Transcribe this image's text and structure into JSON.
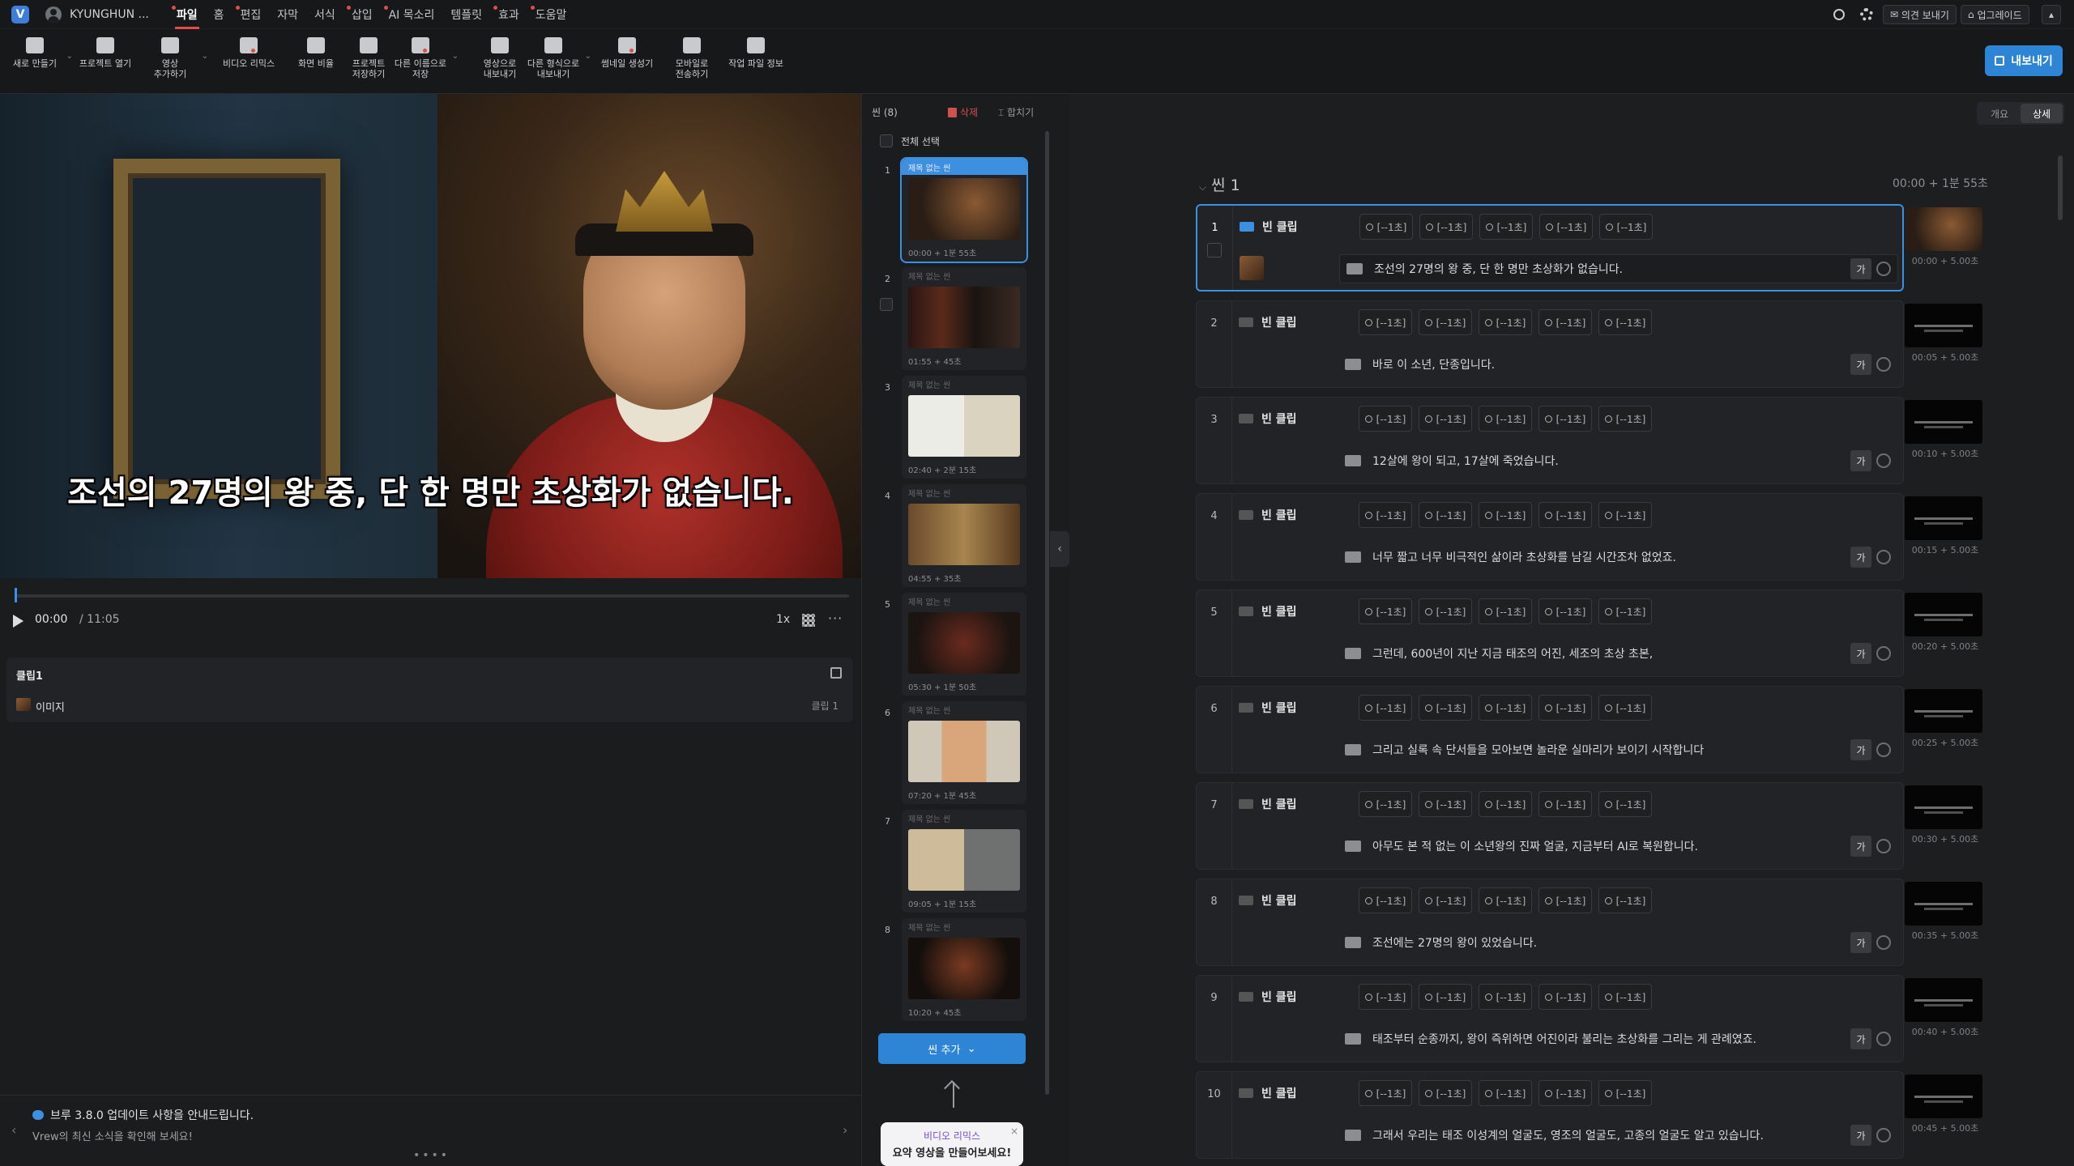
{
  "app": {
    "user": "KYUNGHUN ...",
    "logo": "V"
  },
  "menu": [
    {
      "label": "파일",
      "active": true,
      "dot": true
    },
    {
      "label": "홈",
      "active": false,
      "dot": false
    },
    {
      "label": "편집",
      "active": false,
      "dot": true
    },
    {
      "label": "자막",
      "active": false,
      "dot": false
    },
    {
      "label": "서식",
      "active": false,
      "dot": false
    },
    {
      "label": "삽입",
      "active": false,
      "dot": true
    },
    {
      "label": "AI 목소리",
      "active": false,
      "dot": true
    },
    {
      "label": "템플릿",
      "active": false,
      "dot": false
    },
    {
      "label": "효과",
      "active": false,
      "dot": true
    },
    {
      "label": "도움말",
      "active": false,
      "dot": true
    }
  ],
  "topright": {
    "feedback": "의견 보내기",
    "upgrade": "업그레이드"
  },
  "toolbar": [
    {
      "label": "새로 만들기",
      "icon": "new-project-icon",
      "dot": false,
      "chev": true
    },
    {
      "label": "프로젝트 열기",
      "icon": "folder-icon",
      "dot": false,
      "chev": false
    },
    {
      "label": "영상\n추가하기",
      "icon": "add-video-icon",
      "dot": false,
      "chev": true
    },
    {
      "label": "비디오 리믹스",
      "icon": "remix-icon",
      "dot": true,
      "chev": false
    },
    {
      "label": "화면 비율",
      "icon": "aspect-ratio-icon",
      "dot": false,
      "chev": false
    },
    {
      "label": "프로젝트\n저장하기",
      "icon": "save-icon",
      "dot": false,
      "chev": false
    },
    {
      "label": "다른 이름으로\n저장",
      "icon": "save-as-icon",
      "dot": true,
      "chev": true
    },
    {
      "label": "영상으로\n내보내기",
      "icon": "export-video-icon",
      "dot": false,
      "chev": false
    },
    {
      "label": "다른 형식으로\n내보내기",
      "icon": "export-format-icon",
      "dot": false,
      "chev": true
    },
    {
      "label": "썸네일 생성기",
      "icon": "thumbnail-icon",
      "dot": true,
      "chev": false
    },
    {
      "label": "모바일로\n전송하기",
      "icon": "mobile-icon",
      "dot": false,
      "chev": false
    },
    {
      "label": "작업 파일 정보",
      "icon": "file-info-icon",
      "dot": false,
      "chev": false
    }
  ],
  "export_label": "내보내기",
  "player": {
    "caption": "조선의 27명의 왕 중, 단 한 명만 초상화가 없습니다.",
    "current_time": "00:00",
    "total_time": "/ 11:05",
    "speed": "1x"
  },
  "clip_panel": {
    "title": "클립1",
    "item": "이미지",
    "name": "클립 1"
  },
  "notice": {
    "title": "브루 3.8.0 업데이트 사항을 안내드립니다.",
    "subtitle": "Vrew의 최신 소식을 확인해 보세요!"
  },
  "scenes": {
    "count_label": "씬 (8)",
    "delete_label": "삭제",
    "merge_label": "합치기",
    "select_all": "전체 선택",
    "items": [
      {
        "num": "1",
        "title": "제목 없는 씬",
        "time": "00:00 + 1분 55초"
      },
      {
        "num": "2",
        "title": "제목 없는 씬",
        "time": "01:55 + 45초"
      },
      {
        "num": "3",
        "title": "제목 없는 씬",
        "time": "02:40 + 2분 15초"
      },
      {
        "num": "4",
        "title": "제목 없는 씬",
        "time": "04:55 + 35초"
      },
      {
        "num": "5",
        "title": "제목 없는 씬",
        "time": "05:30 + 1분 50초"
      },
      {
        "num": "6",
        "title": "제목 없는 씬",
        "time": "07:20 + 1분 45초"
      },
      {
        "num": "7",
        "title": "제목 없는 씬",
        "time": "09:05 + 1분 15초"
      },
      {
        "num": "8",
        "title": "제목 없는 씬",
        "time": "10:20 + 45초"
      }
    ],
    "add_label": "씬 추가",
    "tooltip_a": "비디오 리믹스",
    "tooltip_b": "요약 영상을 만들어보세요!"
  },
  "editor": {
    "view_summary": "개요",
    "view_detail": "상세",
    "scene_title": "씬 1",
    "scene_duration": "00:00 + 1분 55초",
    "clip_label": "빈 클립",
    "chip_label": "[--1초]",
    "font_label": "가",
    "clips": [
      {
        "num": "1",
        "caption": "조선의 27명의 왕 중, 단 한 명만 초상화가 없습니다.",
        "time": "00:00 + 5.00초"
      },
      {
        "num": "2",
        "caption": "바로 이 소년, 단종입니다.",
        "time": "00:05 + 5.00초"
      },
      {
        "num": "3",
        "caption": "12살에 왕이 되고, 17살에 죽었습니다.",
        "time": "00:10 + 5.00초"
      },
      {
        "num": "4",
        "caption": "너무 짧고 너무 비극적인 삶이라 초상화를 남길 시간조차 없었죠.",
        "time": "00:15 + 5.00초"
      },
      {
        "num": "5",
        "caption": "그런데, 600년이 지난 지금 태조의 어진, 세조의 초상 초본,",
        "time": "00:20 + 5.00초"
      },
      {
        "num": "6",
        "caption": "그리고 실록 속 단서들을 모아보면 놀라운 실마리가 보이기 시작합니다",
        "time": "00:25 + 5.00초"
      },
      {
        "num": "7",
        "caption": "아무도 본 적 없는 이 소년왕의 진짜 얼굴, 지금부터 AI로 복원합니다.",
        "time": "00:30 + 5.00초"
      },
      {
        "num": "8",
        "caption": "조선에는 27명의 왕이 있었습니다.",
        "time": "00:35 + 5.00초"
      },
      {
        "num": "9",
        "caption": "태조부터 순종까지, 왕이 즉위하면 어진이라 불리는 초상화를 그리는 게 관례였죠.",
        "time": "00:40 + 5.00초"
      },
      {
        "num": "10",
        "caption": "그래서 우리는 태조 이성계의 얼굴도, 영조의 얼굴도, 고종의 얼굴도 알고 있습니다.",
        "time": "00:45 + 5.00초"
      }
    ]
  }
}
